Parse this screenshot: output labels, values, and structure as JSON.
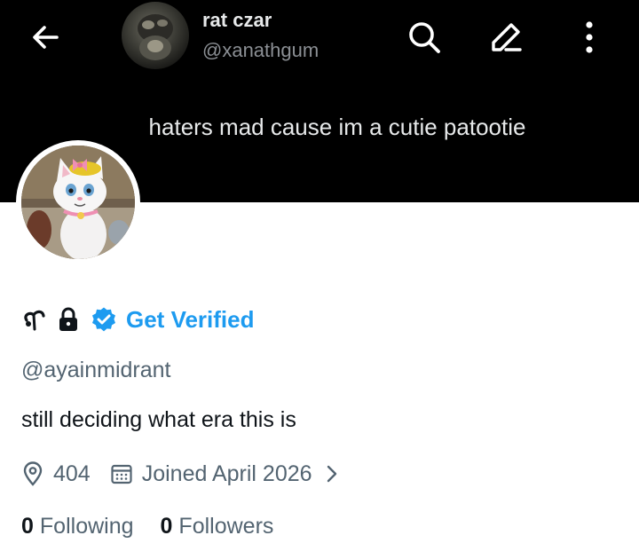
{
  "header": {
    "display_name": "rat czar",
    "handle": "@xanathgum",
    "icons": [
      "back-arrow-icon",
      "search-icon",
      "edit-pencil-icon",
      "more-vertical-icon"
    ]
  },
  "banner": {
    "caption": "haters mad cause im a cutie patootie"
  },
  "profile": {
    "handle": "@ayainmidrant",
    "bio": "still deciding what era this is",
    "get_verified_label": "Get Verified",
    "location": "404",
    "joined": "Joined April 2026",
    "following_count": "0",
    "following_label": "Following",
    "followers_count": "0",
    "followers_label": "Followers"
  },
  "colors": {
    "accent": "#1d9bf0",
    "text_primary": "#0f1419",
    "text_secondary": "#536471",
    "banner_bg": "#000000"
  }
}
